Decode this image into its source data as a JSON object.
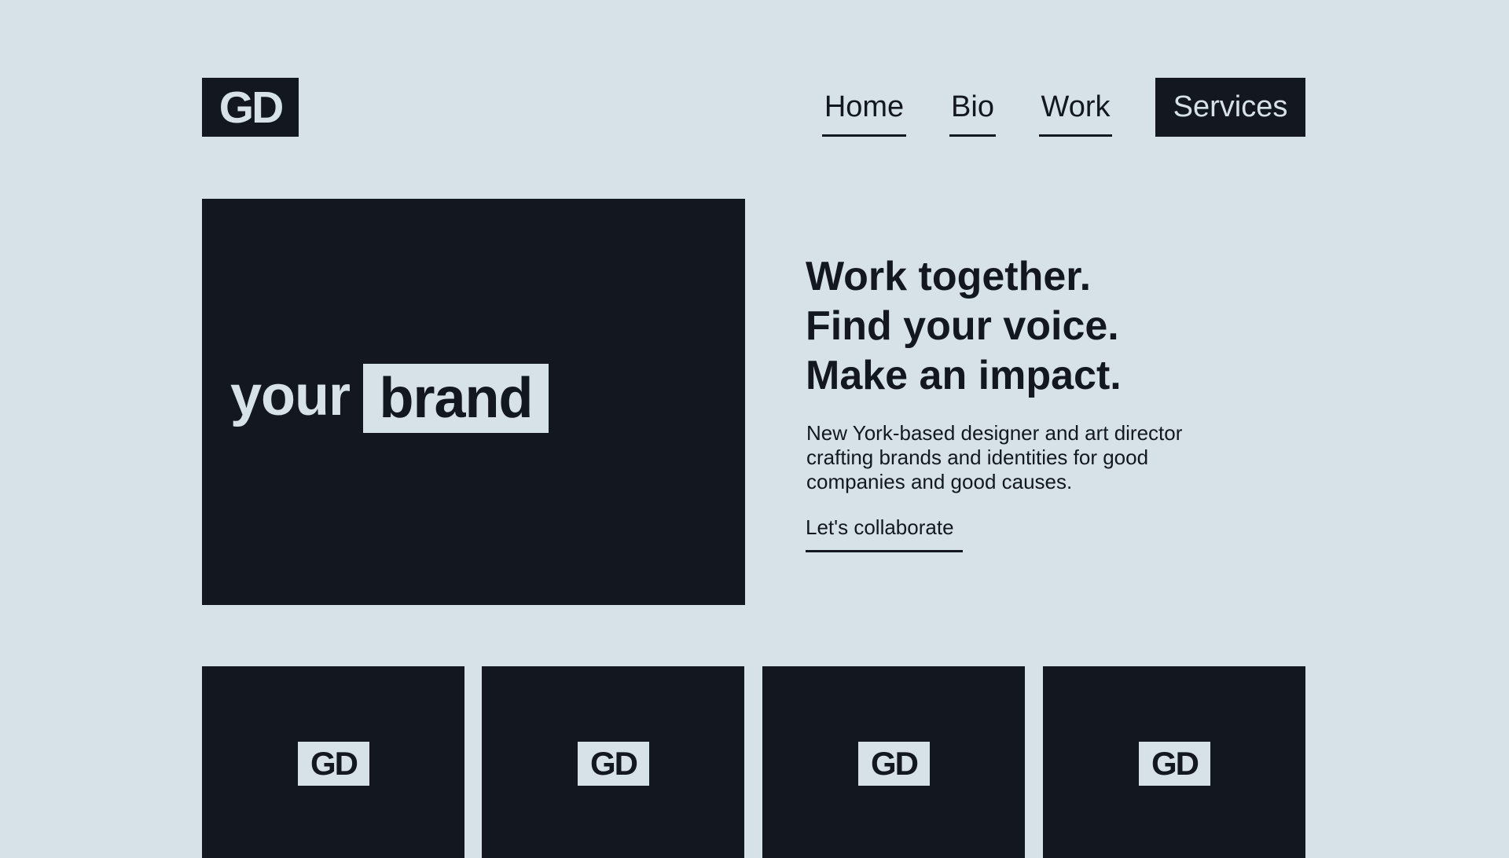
{
  "header": {
    "logo": "GD",
    "nav": {
      "home": "Home",
      "bio": "Bio",
      "work": "Work",
      "services": "Services"
    }
  },
  "hero": {
    "card_word": "your",
    "card_highlight": "brand",
    "headline": [
      "Work together.",
      "Find your voice.",
      "Make an impact."
    ],
    "description": "New York-based designer and art director crafting brands and identities for good companies and good causes.",
    "cta": "Let's collaborate"
  },
  "tiles": [
    {
      "logo": "GD"
    },
    {
      "logo": "GD"
    },
    {
      "logo": "GD"
    },
    {
      "logo": "GD"
    }
  ],
  "colors": {
    "background": "#d7e1e8",
    "ink": "#131820"
  }
}
